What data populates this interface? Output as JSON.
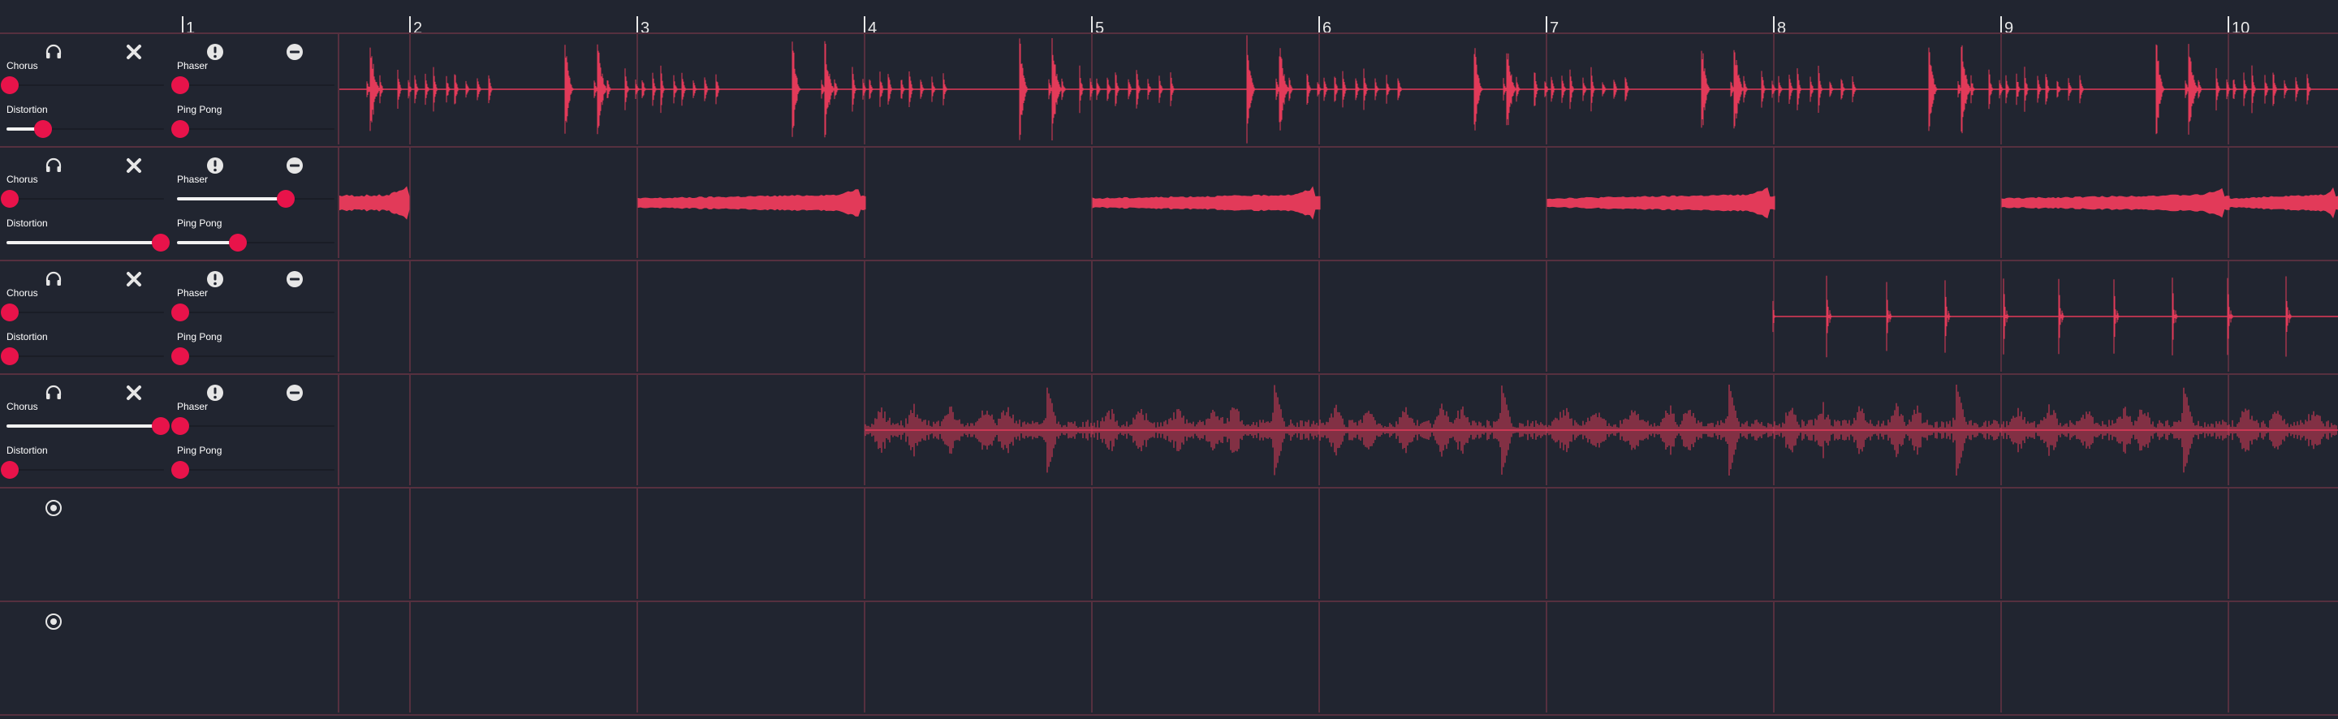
{
  "timeline": {
    "bars": [
      "1",
      "2",
      "3",
      "4",
      "5",
      "6",
      "7",
      "8",
      "9",
      "10"
    ]
  },
  "colors": {
    "background": "#212530",
    "grid": "#56303f",
    "waveform": "#e23a59",
    "knob": "#e8134a",
    "slider_fill": "#f2f2f2"
  },
  "icons": {
    "headphones": "headphones-icon",
    "remove": "close-icon",
    "alert": "alert-icon",
    "minus": "minus-circle-icon",
    "record": "record-icon"
  },
  "tracks": [
    {
      "id": "track-1",
      "has_controls": true,
      "waveform": "drums",
      "params": {
        "chorus": {
          "label": "Chorus",
          "value": 0.0
        },
        "phaser": {
          "label": "Phaser",
          "value": 0.0
        },
        "distortion": {
          "label": "Distortion",
          "value": 0.22
        },
        "pingpong": {
          "label": "Ping Pong",
          "value": 0.0
        }
      }
    },
    {
      "id": "track-2",
      "has_controls": true,
      "waveform": "pads",
      "params": {
        "chorus": {
          "label": "Chorus",
          "value": 0.0
        },
        "phaser": {
          "label": "Phaser",
          "value": 0.7
        },
        "distortion": {
          "label": "Distortion",
          "value": 1.0
        },
        "pingpong": {
          "label": "Ping Pong",
          "value": 0.38
        }
      }
    },
    {
      "id": "track-3",
      "has_controls": true,
      "waveform": "hits",
      "params": {
        "chorus": {
          "label": "Chorus",
          "value": 0.0
        },
        "phaser": {
          "label": "Phaser",
          "value": 0.0
        },
        "distortion": {
          "label": "Distortion",
          "value": 0.0
        },
        "pingpong": {
          "label": "Ping Pong",
          "value": 0.0
        }
      }
    },
    {
      "id": "track-4",
      "has_controls": true,
      "waveform": "noise",
      "params": {
        "chorus": {
          "label": "Chorus",
          "value": 1.0
        },
        "phaser": {
          "label": "Phaser",
          "value": 0.0
        },
        "distortion": {
          "label": "Distortion",
          "value": 0.0
        },
        "pingpong": {
          "label": "Ping Pong",
          "value": 0.0
        }
      }
    },
    {
      "id": "track-5",
      "has_controls": false,
      "waveform": "none"
    },
    {
      "id": "track-6",
      "has_controls": false,
      "waveform": "none"
    }
  ]
}
